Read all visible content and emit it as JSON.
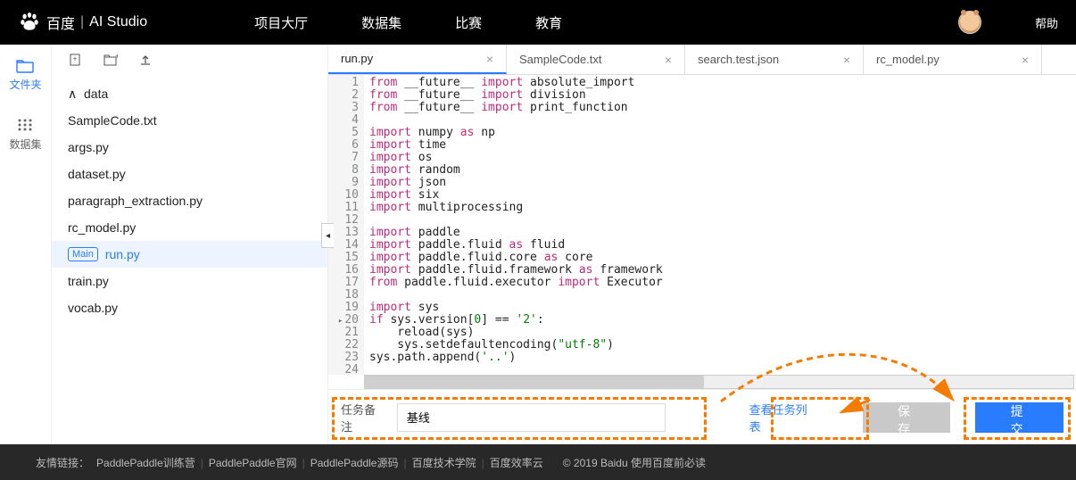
{
  "header": {
    "brand_left": "百度",
    "brand_right": "AI Studio",
    "nav": [
      "项目大厅",
      "数据集",
      "比赛",
      "教育"
    ],
    "help": "帮助"
  },
  "rail": {
    "files": "文件夹",
    "dataset": "数据集"
  },
  "tree": {
    "root": "data",
    "items": [
      "SampleCode.txt",
      "args.py",
      "dataset.py",
      "paragraph_extraction.py",
      "rc_model.py"
    ],
    "main_badge": "Main",
    "main_file": "run.py",
    "rest": [
      "train.py",
      "vocab.py"
    ]
  },
  "tabs": [
    {
      "label": "run.py",
      "active": true
    },
    {
      "label": "SampleCode.txt",
      "active": false
    },
    {
      "label": "search.test.json",
      "active": false
    },
    {
      "label": "rc_model.py",
      "active": false
    }
  ],
  "code_lines": [
    {
      "n": 1,
      "html": "<span class='kw'>from</span> __future__ <span class='imp'>import</span> absolute_import"
    },
    {
      "n": 2,
      "html": "<span class='kw'>from</span> __future__ <span class='imp'>import</span> division"
    },
    {
      "n": 3,
      "html": "<span class='kw'>from</span> __future__ <span class='imp'>import</span> print_function"
    },
    {
      "n": 4,
      "html": ""
    },
    {
      "n": 5,
      "html": "<span class='imp'>import</span> numpy <span class='as'>as</span> np"
    },
    {
      "n": 6,
      "html": "<span class='imp'>import</span> time"
    },
    {
      "n": 7,
      "html": "<span class='imp'>import</span> os"
    },
    {
      "n": 8,
      "html": "<span class='imp'>import</span> random"
    },
    {
      "n": 9,
      "html": "<span class='imp'>import</span> json"
    },
    {
      "n": 10,
      "html": "<span class='imp'>import</span> six"
    },
    {
      "n": 11,
      "html": "<span class='imp'>import</span> multiprocessing"
    },
    {
      "n": 12,
      "html": ""
    },
    {
      "n": 13,
      "html": "<span class='imp'>import</span> paddle"
    },
    {
      "n": 14,
      "html": "<span class='imp'>import</span> paddle.fluid <span class='as'>as</span> fluid"
    },
    {
      "n": 15,
      "html": "<span class='imp'>import</span> paddle.fluid.core <span class='as'>as</span> core"
    },
    {
      "n": 16,
      "html": "<span class='imp'>import</span> paddle.fluid.framework <span class='as'>as</span> framework"
    },
    {
      "n": 17,
      "html": "<span class='kw'>from</span> paddle.fluid.executor <span class='imp'>import</span> Executor"
    },
    {
      "n": 18,
      "html": ""
    },
    {
      "n": 19,
      "html": "<span class='imp'>import</span> sys"
    },
    {
      "n": 20,
      "html": "<span class='kw'>if</span> sys.version[<span class='num'>0</span>] == <span class='str'>'2'</span>:",
      "fold": true
    },
    {
      "n": 21,
      "html": "    reload(sys)"
    },
    {
      "n": 22,
      "html": "    sys.setdefaultencoding(<span class='str'>\"utf-8\"</span>)"
    },
    {
      "n": 23,
      "html": "sys.path.append(<span class='str'>'..'</span>)"
    },
    {
      "n": 24,
      "html": ""
    }
  ],
  "bottom": {
    "note_label": "任务备注",
    "note_value": "基线",
    "view_tasks": "查看任务列表",
    "save": "保 存",
    "submit": "提 交"
  },
  "footer": {
    "label": "友情链接：",
    "links": [
      "PaddlePaddle训练营",
      "PaddlePaddle官网",
      "PaddlePaddle源码",
      "百度技术学院",
      "百度效率云"
    ],
    "copyright": "© 2019 Baidu 使用百度前必读"
  }
}
